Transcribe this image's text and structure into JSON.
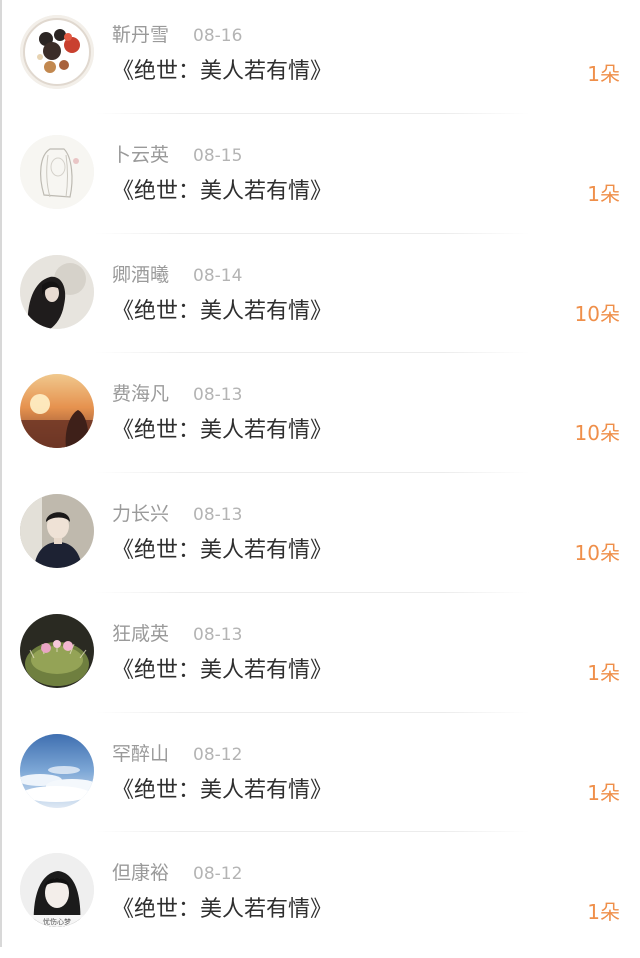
{
  "rows": [
    {
      "name": "靳丹雪",
      "date": "08-16",
      "book": "《绝世：美人若有情》",
      "count": "1朵",
      "avatar": "avatar-food-plate-icon"
    },
    {
      "name": "卜云英",
      "date": "08-15",
      "book": "《绝世：美人若有情》",
      "count": "1朵",
      "avatar": "avatar-sketch-girl-icon"
    },
    {
      "name": "卿酒曦",
      "date": "08-14",
      "book": "《绝世：美人若有情》",
      "count": "10朵",
      "avatar": "avatar-dark-hair-girl-icon"
    },
    {
      "name": "费海凡",
      "date": "08-13",
      "book": "《绝世：美人若有情》",
      "count": "10朵",
      "avatar": "avatar-sunset-icon"
    },
    {
      "name": "力长兴",
      "date": "08-13",
      "book": "《绝世：美人若有情》",
      "count": "10朵",
      "avatar": "avatar-boy-portrait-icon"
    },
    {
      "name": "狂咸英",
      "date": "08-13",
      "book": "《绝世：美人若有情》",
      "count": "1朵",
      "avatar": "avatar-cactus-flower-icon"
    },
    {
      "name": "罕醉山",
      "date": "08-12",
      "book": "《绝世：美人若有情》",
      "count": "1朵",
      "avatar": "avatar-sky-clouds-icon"
    },
    {
      "name": "但康裕",
      "date": "08-12",
      "book": "《绝世：美人若有情》",
      "count": "1朵",
      "avatar": "avatar-girl-bw-icon",
      "avatar_caption": "忧伤心梦"
    }
  ],
  "colors": {
    "name": "#9a9a9a",
    "date": "#b4b4b4",
    "book": "#2f2f2f",
    "count": "#ef8f4a"
  }
}
